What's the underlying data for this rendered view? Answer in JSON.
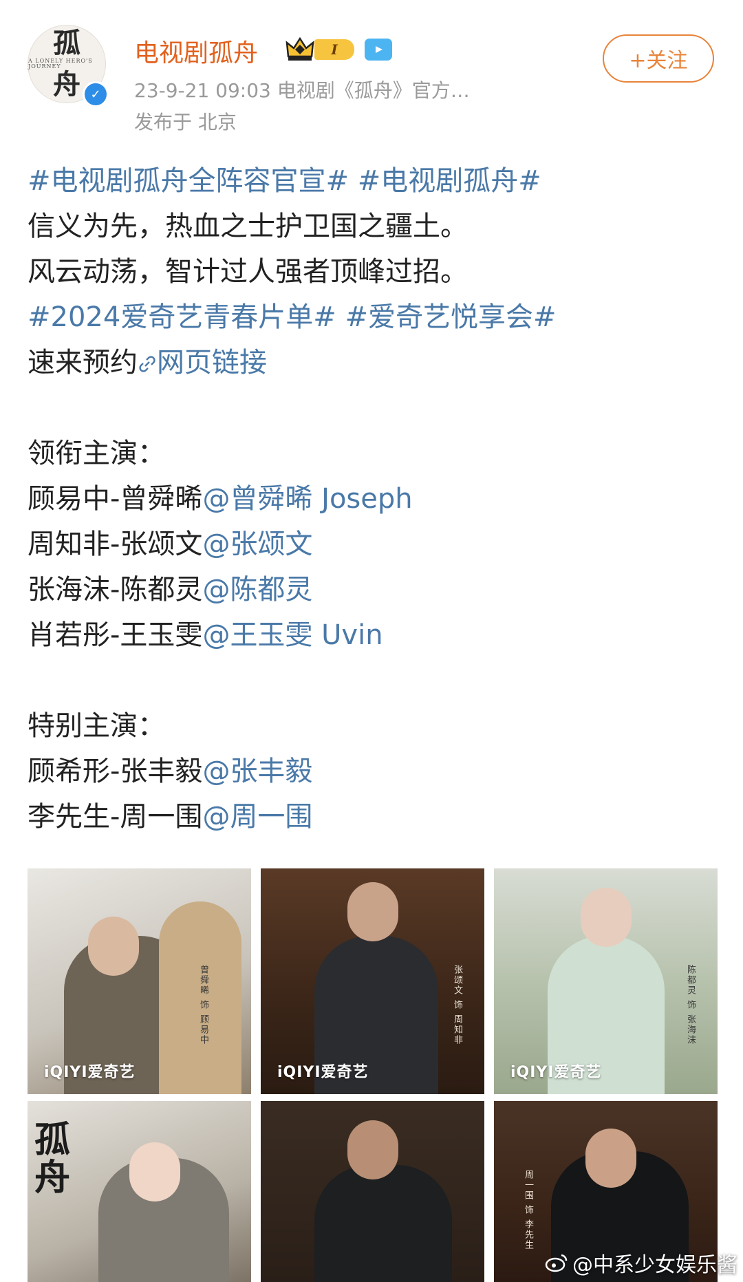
{
  "header": {
    "account_name": "电视剧孤舟",
    "avatar_text": [
      "孤",
      "A LONELY HERO'S JOURNEY",
      "舟"
    ],
    "level_badge": "I",
    "meta": "23-9-21 09:03  电视剧《孤舟》官方…",
    "location": "发布于 北京",
    "follow_label": "+关注"
  },
  "post": {
    "line1_tags": "#电视剧孤舟全阵容官宣# #电视剧孤舟#",
    "line2": "信义为先，热血之士护卫国之疆土。",
    "line3": "风云动荡，智计过人强者顶峰过招。",
    "line4_tags": "#2024爱奇艺青春片单# #爱奇艺悦享会#",
    "line5_text": "速来预约",
    "link_label": "网页链接",
    "lead_heading": "领衔主演：",
    "lead_cast": [
      {
        "role": "顾易中-曾舜晞",
        "mention": "@曾舜晞 Joseph"
      },
      {
        "role": "周知非-张颂文",
        "mention": "@张颂文"
      },
      {
        "role": "张海沫-陈都灵",
        "mention": "@陈都灵"
      },
      {
        "role": "肖若彤-王玉雯",
        "mention": "@王玉雯 Uvin"
      }
    ],
    "special_heading": "特别主演：",
    "special_cast": [
      {
        "role": "顾希形-张丰毅",
        "mention": "@张丰毅"
      },
      {
        "role": "李先生-周一围",
        "mention": "@周一围"
      }
    ]
  },
  "photos": [
    {
      "brand": "iQIYI爱奇艺",
      "caption": "曾舜晞 饰 顾易中"
    },
    {
      "brand": "iQIYI爱奇艺",
      "caption": "张颂文 饰 周知非"
    },
    {
      "brand": "iQIYI爱奇艺",
      "caption": "陈都灵 饰 张海沫"
    },
    {
      "brand": "",
      "caption": "",
      "poster_title": "孤\n舟"
    },
    {
      "brand": "",
      "caption": ""
    },
    {
      "brand": "",
      "caption": "周一围 饰 李先生"
    }
  ],
  "watermark": "@中系少女娱乐酱",
  "colors": {
    "accent": "#e2611e",
    "link": "#4a79a8",
    "follow": "#e8833a",
    "meta": "#9a9a9a"
  }
}
